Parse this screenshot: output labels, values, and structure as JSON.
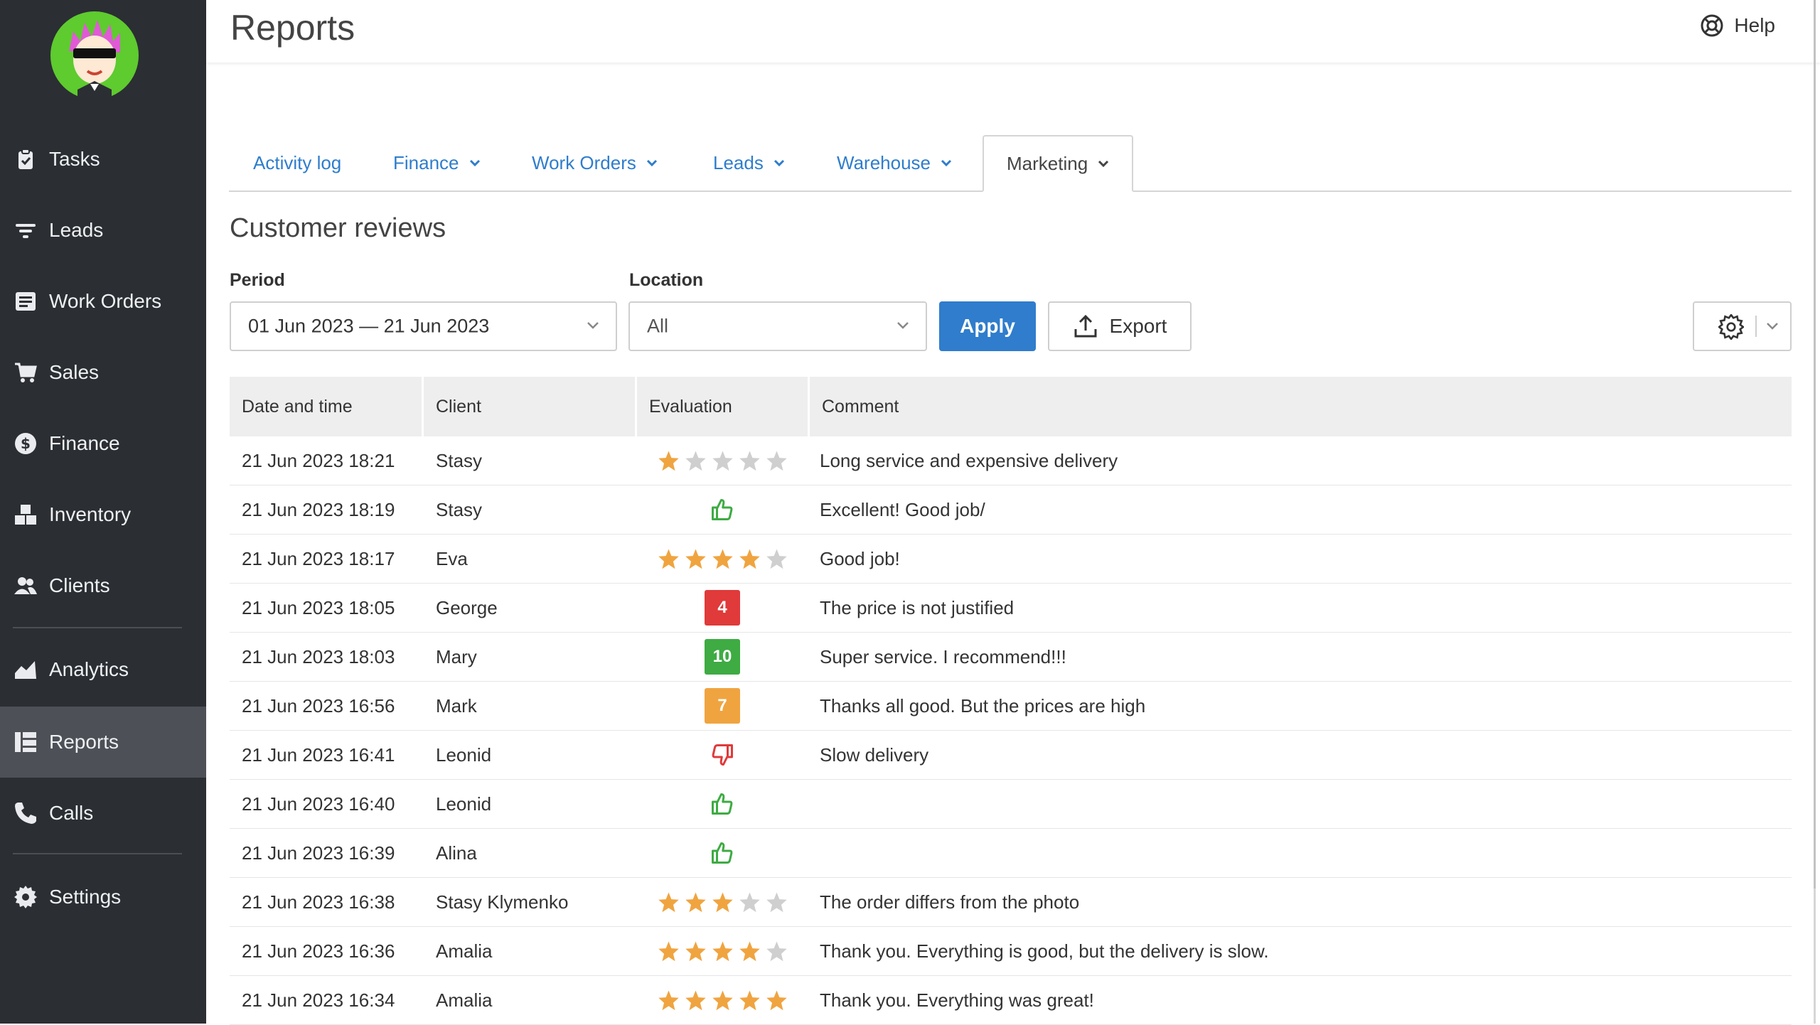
{
  "app": {
    "page_title": "Reports",
    "help_label": "Help"
  },
  "sidebar": {
    "items": [
      {
        "label": "Tasks",
        "icon": "clipboard-icon"
      },
      {
        "label": "Leads",
        "icon": "filter-icon"
      },
      {
        "label": "Work Orders",
        "icon": "work-order-icon"
      },
      {
        "label": "Sales",
        "icon": "cart-icon"
      },
      {
        "label": "Finance",
        "icon": "dollar-icon"
      },
      {
        "label": "Inventory",
        "icon": "boxes-icon"
      },
      {
        "label": "Clients",
        "icon": "users-icon"
      },
      {
        "label": "Analytics",
        "icon": "chart-icon"
      },
      {
        "label": "Reports",
        "icon": "table-icon",
        "active": true
      },
      {
        "label": "Calls",
        "icon": "phone-icon"
      },
      {
        "label": "Settings",
        "icon": "gear-icon"
      }
    ]
  },
  "tabs": [
    {
      "label": "Activity log",
      "has_dropdown": false
    },
    {
      "label": "Finance",
      "has_dropdown": true
    },
    {
      "label": "Work Orders",
      "has_dropdown": true
    },
    {
      "label": "Leads",
      "has_dropdown": true
    },
    {
      "label": "Warehouse",
      "has_dropdown": true
    },
    {
      "label": "Marketing",
      "has_dropdown": true,
      "active": true
    }
  ],
  "section": {
    "title": "Customer reviews"
  },
  "filters": {
    "period_label": "Period",
    "period_value": "01 Jun 2023 — 21 Jun 2023",
    "location_label": "Location",
    "location_value": "All",
    "apply_label": "Apply",
    "export_label": "Export"
  },
  "table": {
    "headers": [
      "Date and time",
      "Client",
      "Evaluation",
      "Comment"
    ],
    "rows": [
      {
        "date": "21 Jun 2023 18:21",
        "client": "Stasy",
        "eval": {
          "type": "stars",
          "value": 1,
          "max": 5
        },
        "comment": "Long service and expensive delivery"
      },
      {
        "date": "21 Jun 2023 18:19",
        "client": "Stasy",
        "eval": {
          "type": "thumb",
          "value": "up"
        },
        "comment": "Excellent! Good job/"
      },
      {
        "date": "21 Jun 2023 18:17",
        "client": "Eva",
        "eval": {
          "type": "stars",
          "value": 4,
          "max": 5
        },
        "comment": "Good job!"
      },
      {
        "date": "21 Jun 2023 18:05",
        "client": "George",
        "eval": {
          "type": "score",
          "value": "4",
          "color": "#e03a3a"
        },
        "comment": "The price is not justified"
      },
      {
        "date": "21 Jun 2023 18:03",
        "client": "Mary",
        "eval": {
          "type": "score",
          "value": "10",
          "color": "#3eab43"
        },
        "comment": "Super service. I recommend!!!"
      },
      {
        "date": "21 Jun 2023 16:56",
        "client": "Mark",
        "eval": {
          "type": "score",
          "value": "7",
          "color": "#f0a440"
        },
        "comment": "Thanks all good. But the prices are high"
      },
      {
        "date": "21 Jun 2023 16:41",
        "client": "Leonid",
        "eval": {
          "type": "thumb",
          "value": "down"
        },
        "comment": "Slow delivery"
      },
      {
        "date": "21 Jun 2023 16:40",
        "client": "Leonid",
        "eval": {
          "type": "thumb",
          "value": "up"
        },
        "comment": ""
      },
      {
        "date": "21 Jun 2023 16:39",
        "client": "Alina",
        "eval": {
          "type": "thumb",
          "value": "up"
        },
        "comment": ""
      },
      {
        "date": "21 Jun 2023 16:38",
        "client": "Stasy Klymenko",
        "eval": {
          "type": "stars",
          "value": 3,
          "max": 5
        },
        "comment": "The order differs from the photo"
      },
      {
        "date": "21 Jun 2023 16:36",
        "client": "Amalia",
        "eval": {
          "type": "stars",
          "value": 4,
          "max": 5
        },
        "comment": "Thank you. Everything is good, but the delivery is slow."
      },
      {
        "date": "21 Jun 2023 16:34",
        "client": "Amalia",
        "eval": {
          "type": "stars",
          "value": 5,
          "max": 5
        },
        "comment": "Thank you. Everything was great!"
      }
    ]
  },
  "colors": {
    "sidebar_bg": "#2b2e33",
    "sidebar_active": "#4d5157",
    "accent": "#2f7dcc",
    "star_on": "#f0a440",
    "star_off": "#cfcfcf",
    "thumb_up": "#3eab43",
    "thumb_down": "#e03a3a"
  }
}
